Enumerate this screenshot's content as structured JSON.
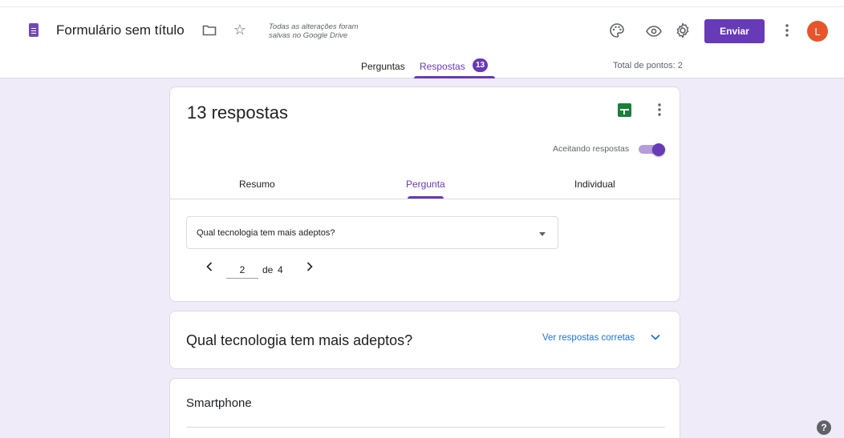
{
  "header": {
    "form_title": "Formulário sem título",
    "saved_line1": "Todas as alterações foram",
    "saved_line2": "salvas no Google Drive",
    "send_label": "Enviar",
    "avatar_initial": "L"
  },
  "tabs": {
    "questions_label": "Perguntas",
    "responses_label": "Respostas",
    "responses_badge": "13",
    "total_points": "Total de pontos: 2"
  },
  "summary_card": {
    "responses_count": "13 respostas",
    "accepting_label": "Aceitando respostas",
    "accepting": true,
    "subtabs": {
      "summary": "Resumo",
      "question": "Pergunta",
      "individual": "Individual"
    },
    "question_select_value": "Qual tecnologia tem mais adeptos?",
    "pager": {
      "current": "2",
      "of_label": "de",
      "total": "4"
    }
  },
  "question_card": {
    "title": "Qual tecnologia tem mais adeptos?",
    "view_correct_label": "Ver respostas corretas"
  },
  "option_card": {
    "title": "Smartphone"
  },
  "help_label": "?",
  "colors": {
    "accent": "#673ab7",
    "background": "#f0ebf8",
    "link": "#1a73e8",
    "avatar": "#e8552a",
    "sheets": "#188038"
  }
}
